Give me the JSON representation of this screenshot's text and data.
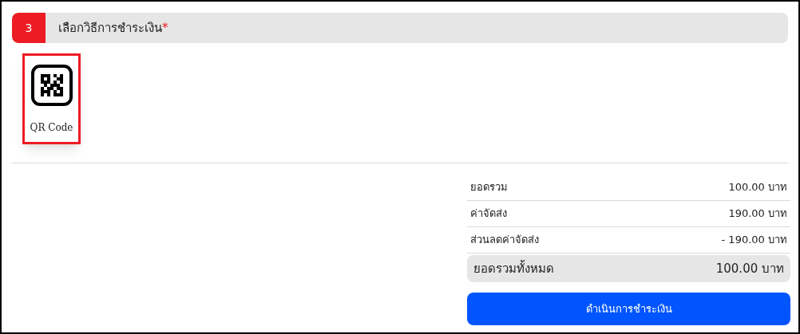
{
  "section": {
    "number": "3",
    "title": "เลือกวิธีการชำระเงิน",
    "required_mark": "*"
  },
  "payment_methods": [
    {
      "label": "QR Code",
      "selected": true
    }
  ],
  "summary": {
    "rows": [
      {
        "label": "ยอดรวม",
        "value": "100.00 บาท"
      },
      {
        "label": "ค่าจัดส่ง",
        "value": "190.00 บาท"
      },
      {
        "label": "ส่วนลดค่าจัดส่ง",
        "value": "- 190.00 บาท"
      }
    ],
    "total": {
      "label": "ยอดรวมทั้งหมด",
      "value": "100.00 บาท"
    }
  },
  "pay_button": "ดำเนินการชำระเงิน"
}
